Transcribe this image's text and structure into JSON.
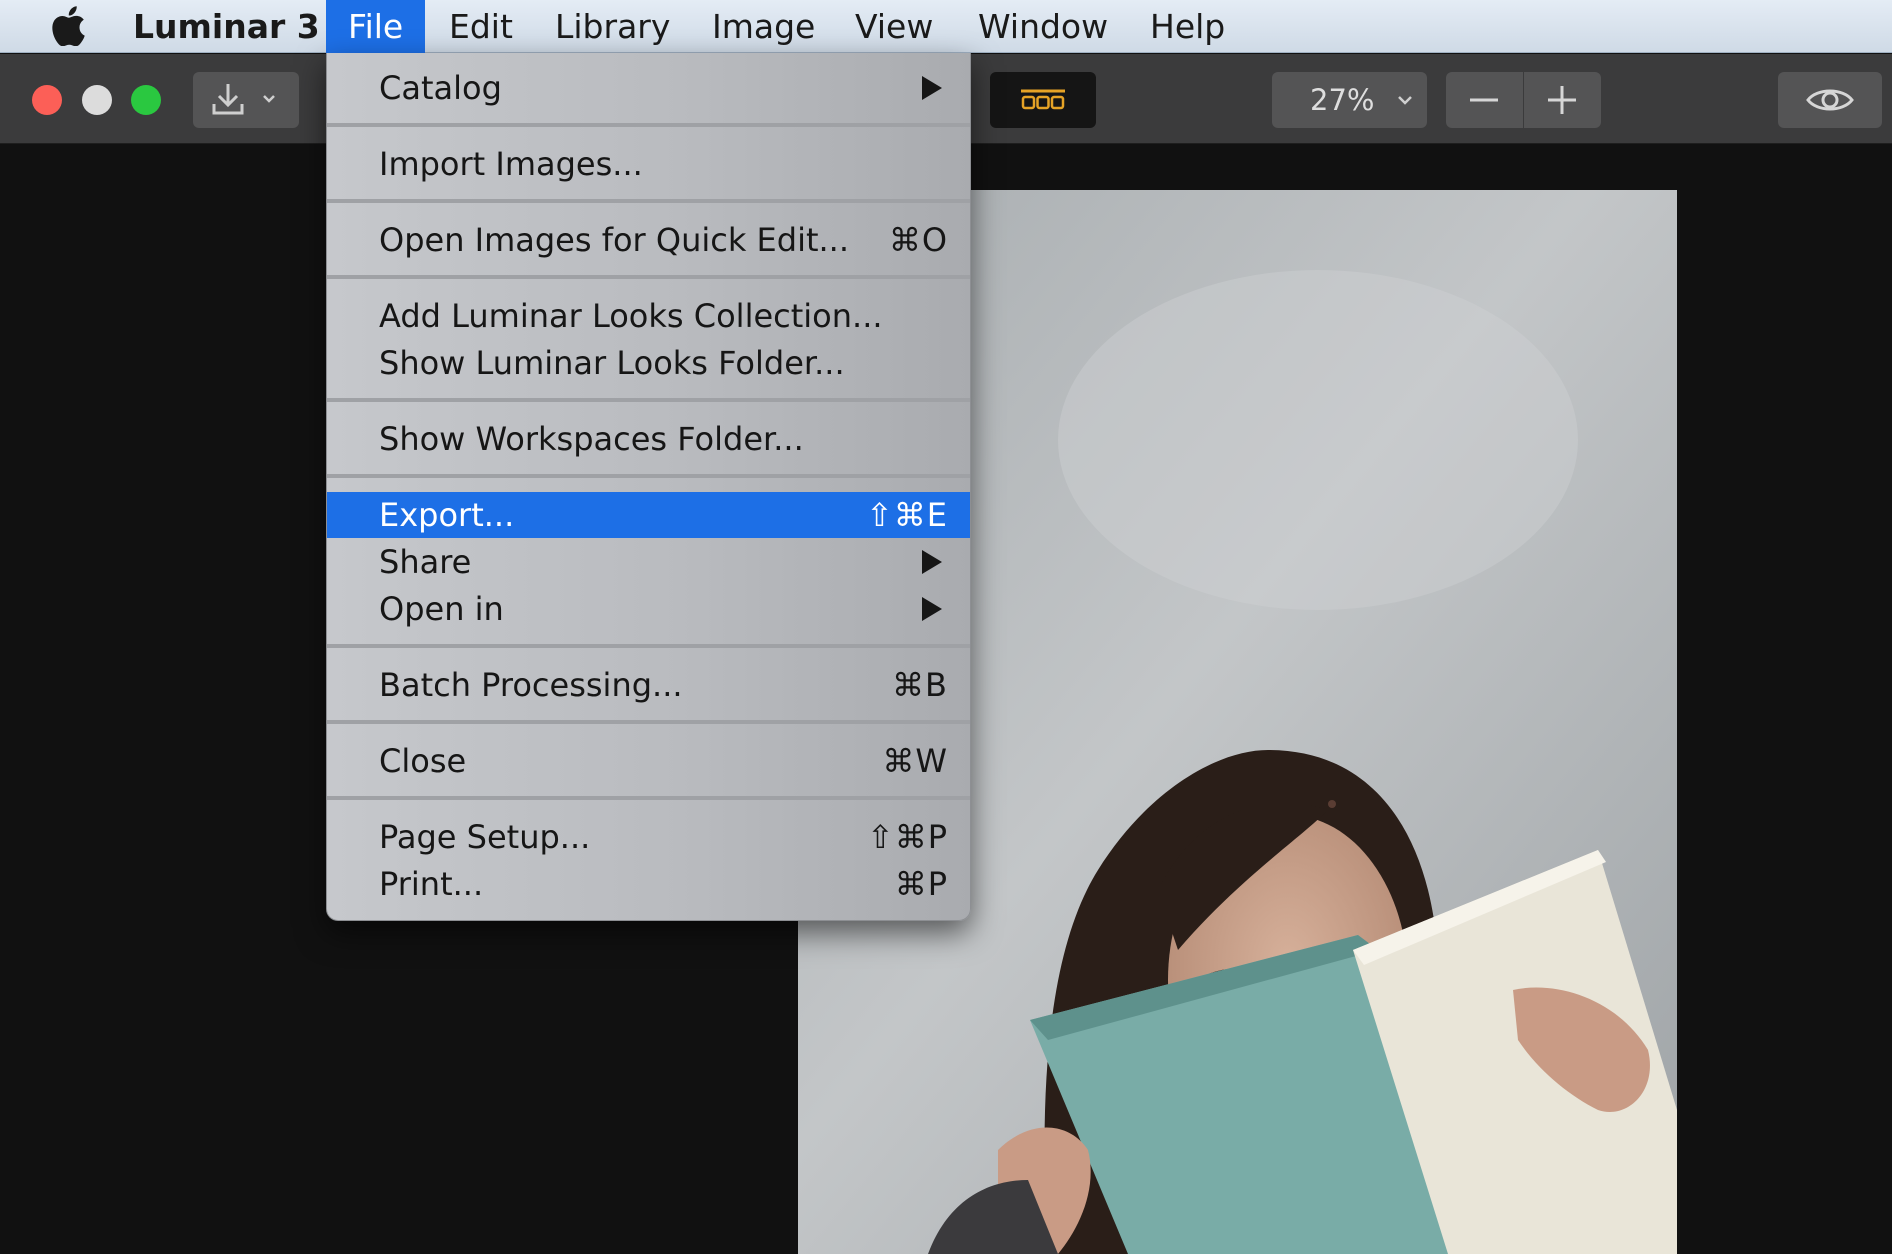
{
  "menubar": {
    "app_name": "Luminar 3",
    "items": [
      "File",
      "Edit",
      "Library",
      "Image",
      "View",
      "Window",
      "Help"
    ],
    "active_item": "File"
  },
  "toolbar": {
    "zoom_value": "27%",
    "zoom_out_symbol": "−",
    "zoom_in_symbol": "+"
  },
  "file_menu": {
    "catalog": "Catalog",
    "import_images": "Import Images...",
    "open_quick_edit": "Open Images for Quick Edit...",
    "open_quick_edit_shortcut": "⌘O",
    "add_looks": "Add Luminar Looks Collection...",
    "show_looks": "Show Luminar Looks Folder...",
    "show_workspaces": "Show Workspaces Folder...",
    "export": "Export...",
    "export_shortcut": "⇧⌘E",
    "share": "Share",
    "open_in": "Open in",
    "batch": "Batch Processing...",
    "batch_shortcut": "⌘B",
    "close": "Close",
    "close_shortcut": "⌘W",
    "page_setup": "Page Setup...",
    "page_setup_shortcut": "⇧⌘P",
    "print": "Print...",
    "print_shortcut": "⌘P"
  },
  "colors": {
    "menu_highlight": "#1d6fe6",
    "traffic_close": "#fc5f57",
    "traffic_max": "#2ac840",
    "filmstrip_icon": "#e6a326"
  }
}
